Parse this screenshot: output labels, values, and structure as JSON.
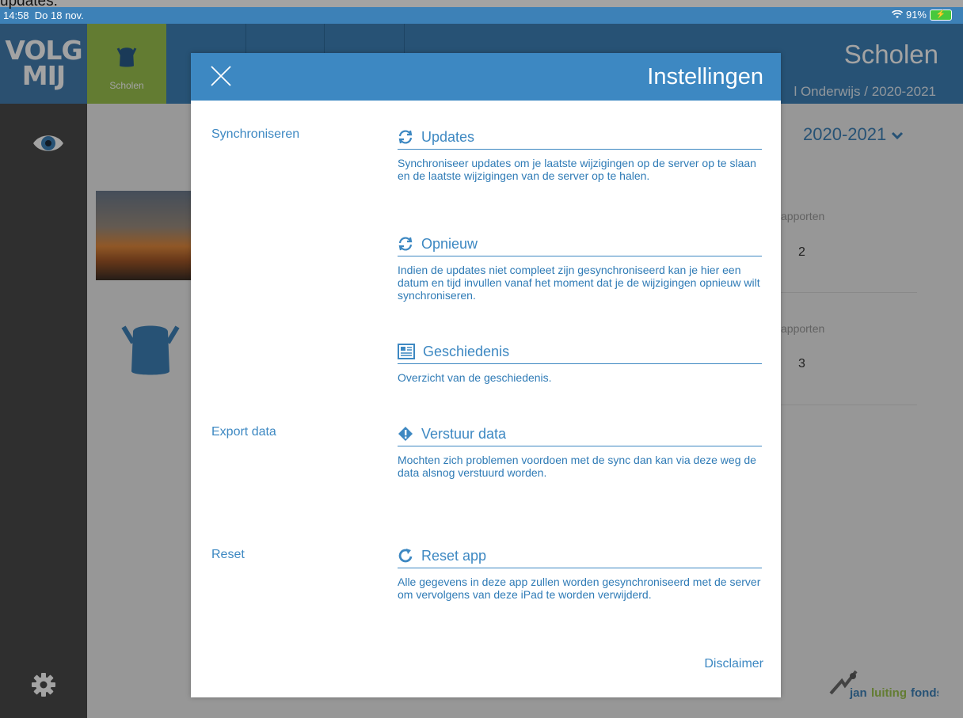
{
  "caption": "updates:",
  "status": {
    "time": "14:58",
    "date": "Do 18 nov.",
    "battery": "91%"
  },
  "app": {
    "logo_line1": "VOLG",
    "logo_line2": "MIJ",
    "active_tab": "Scholen",
    "page_title": "Scholen",
    "page_subtitle": "l Onderwijs / 2020-2021"
  },
  "background": {
    "year": "2020-2021",
    "rapporten_label": "apporten",
    "count_1": "2",
    "count_2": "3",
    "fonds": "janluitingfonds"
  },
  "modal": {
    "title": "Instellingen",
    "sections": [
      {
        "label": "Synchroniseren"
      },
      {
        "label": "Export data"
      },
      {
        "label": "Reset"
      }
    ],
    "items": [
      {
        "title": "Updates",
        "icon": "sync-icon",
        "description": "Synchroniseer updates om je laatste wijzigingen op de server op te slaan en de laatste wijzigingen van de server op te halen."
      },
      {
        "title": "Opnieuw",
        "icon": "sync-icon",
        "description": "Indien de updates niet compleet zijn gesynchroniseerd kan je hier een datum en tijd invullen vanaf het moment dat je de wijzigingen opnieuw wilt synchroniseren."
      },
      {
        "title": "Geschiedenis",
        "icon": "news-icon",
        "description": "Overzicht van de geschiedenis."
      },
      {
        "title": "Verstuur data",
        "icon": "alert-icon",
        "description": "Mochten zich problemen voordoen met de sync dan kan via deze weg de data alsnog verstuurd worden."
      },
      {
        "title": "Reset app",
        "icon": "reset-icon",
        "description": "Alle gegevens in deze app zullen worden gesynchroniseerd met de server om vervolgens van deze iPad te worden verwijderd."
      }
    ],
    "disclaimer": "Disclaimer"
  }
}
